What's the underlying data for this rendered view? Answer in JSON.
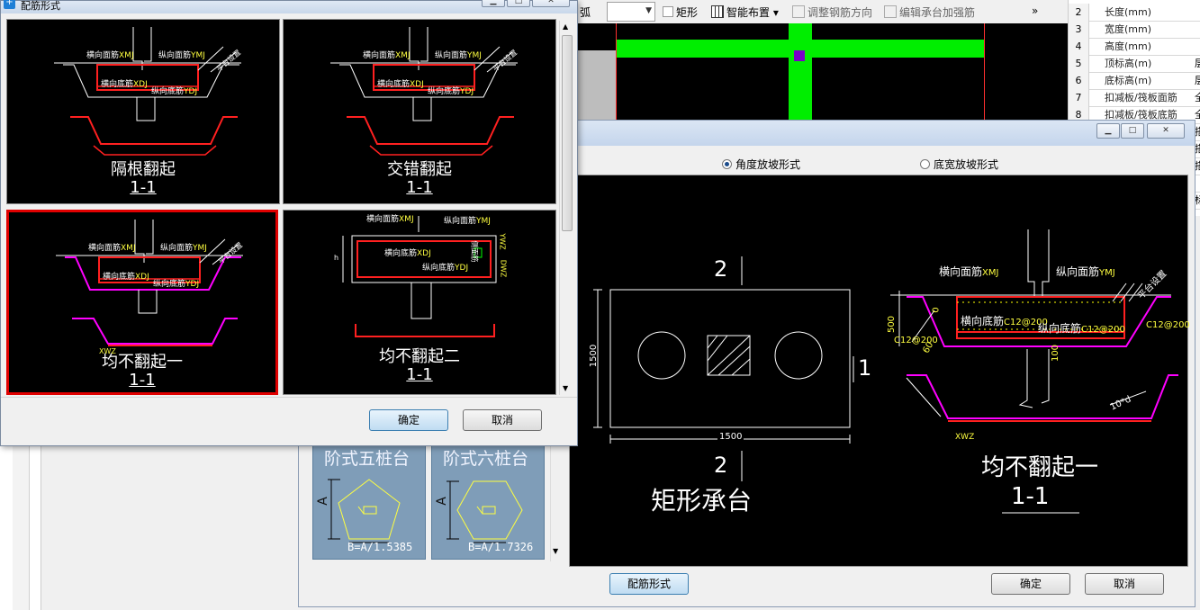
{
  "toolbar": {
    "arc_label": "弧",
    "combo_value": "",
    "rect_label": "矩形",
    "smart_layout_label": "智能布置",
    "adjust_direction_label": "调整钢筋方向",
    "edit_cap_label": "编辑承台加强筋",
    "overflow": "»"
  },
  "properties": {
    "rows": [
      {
        "num": "2",
        "name": "长度(mm)",
        "value": ""
      },
      {
        "num": "3",
        "name": "宽度(mm)",
        "value": ""
      },
      {
        "num": "4",
        "name": "高度(mm)",
        "value": ""
      },
      {
        "num": "5",
        "name": "顶标高(m)",
        "value": "层"
      },
      {
        "num": "6",
        "name": "底标高(m)",
        "value": "层"
      },
      {
        "num": "7",
        "name": "扣减板/筏板面筋",
        "value": "全"
      },
      {
        "num": "8",
        "name": "扣减板/筏板底筋",
        "value": "全"
      },
      {
        "num": "",
        "name": "",
        "value": "搭"
      },
      {
        "num": "",
        "name": "",
        "value": "搭"
      },
      {
        "num": "",
        "name": "",
        "value": "搭"
      },
      {
        "num": "",
        "name": "",
        "value": ""
      },
      {
        "num": "",
        "name": "",
        "value": "标"
      }
    ]
  },
  "rebar_dialog": {
    "title": "配筋形式",
    "options": [
      {
        "name": "隔根翻起",
        "section": "1-1"
      },
      {
        "name": "交错翻起",
        "section": "1-1"
      },
      {
        "name": "均不翻起一",
        "section": "1-1"
      },
      {
        "name": "均不翻起二",
        "section": "1-1"
      }
    ],
    "selected_index": 2,
    "ok": "确定",
    "cancel": "取消",
    "cad_labels": {
      "top_transverse": "横向面筋",
      "top_longitudinal": "纵向面筋",
      "bottom_transverse": "横向底筋",
      "bottom_longitudinal": "纵向底筋",
      "code_xmj": "XMJ",
      "code_ymj": "YMJ",
      "code_xdj": "XDJ",
      "code_ydj": "YDJ",
      "code_xwz": "XWZ",
      "code_ywz": "YWZ",
      "code_cmjz": "CMJZ",
      "code_dwz": "DWZ",
      "slope_note": "平台设置",
      "side_note": "侧面筋",
      "h": "h"
    }
  },
  "cap_dialog": {
    "radio_angle": "角度放坡形式",
    "radio_bottom_width": "底宽放坡形式",
    "radio_selected": "angle",
    "thumbnails": [
      {
        "title": "阶式五桩台",
        "formula": "B=A/1.5385",
        "dim": "A"
      },
      {
        "title": "阶式六桩台",
        "formula": "B=A/1.7326",
        "dim": "A"
      }
    ],
    "rebar_form_button": "配筋形式",
    "ok": "确定",
    "cancel": "取消",
    "preview": {
      "plan_name": "矩形承台",
      "section_mark": "2",
      "section_mark_side": "1",
      "dim_width": "1500",
      "dim_height": "1500",
      "section_name": "均不翻起一",
      "section_label": "1-1",
      "top_transverse": "横向面筋",
      "top_transverse_code": "XMJ",
      "top_longitudinal": "纵向面筋",
      "top_longitudinal_code": "YMJ",
      "bottom_transverse": "横向底筋",
      "bottom_transverse_spec": "C12@200",
      "bottom_longitudinal": "纵向底筋",
      "bottom_longitudinal_spec": "C12@200",
      "left_spec": "C12@200",
      "right_spec": "C12@200",
      "dim_500": "500",
      "dim_100": "100",
      "dim_60": "60",
      "dim_0": "0",
      "dim_10d": "10*d",
      "code_xwz": "XWZ",
      "slope_note": "平台设置"
    }
  },
  "colors": {
    "cad_bg": "#000000",
    "rebar_red": "#ff2020",
    "rebar_magenta": "#ff00ff",
    "cad_green": "#00ff00",
    "cad_yellow": "#ffff00",
    "highlight": "#e00000"
  }
}
